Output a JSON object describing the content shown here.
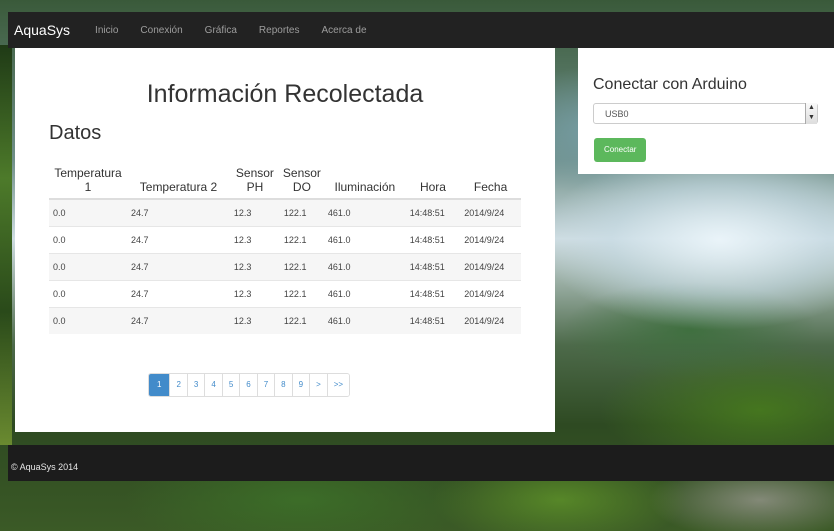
{
  "navbar": {
    "brand": "AquaSys",
    "items": [
      "Inicio",
      "Conexión",
      "Gráfica",
      "Reportes",
      "Acerca de"
    ]
  },
  "main": {
    "title": "Información Recolectada",
    "subtitle": "Datos",
    "columns": [
      "Temperatura 1",
      "Temperatura 2",
      "Sensor PH",
      "Sensor DO",
      "Iluminación",
      "Hora",
      "Fecha"
    ],
    "rows": [
      [
        "0.0",
        "24.7",
        "12.3",
        "122.1",
        "461.0",
        "14:48:51",
        "2014/9/24"
      ],
      [
        "0.0",
        "24.7",
        "12.3",
        "122.1",
        "461.0",
        "14:48:51",
        "2014/9/24"
      ],
      [
        "0.0",
        "24.7",
        "12.3",
        "122.1",
        "461.0",
        "14:48:51",
        "2014/9/24"
      ],
      [
        "0.0",
        "24.7",
        "12.3",
        "122.1",
        "461.0",
        "14:48:51",
        "2014/9/24"
      ],
      [
        "0.0",
        "24.7",
        "12.3",
        "122.1",
        "461.0",
        "14:48:51",
        "2014/9/24"
      ]
    ],
    "pagination": [
      "1",
      "2",
      "3",
      "4",
      "5",
      "6",
      "7",
      "8",
      "9",
      ">",
      ">>"
    ],
    "active_page": "1"
  },
  "side": {
    "title": "Conectar con Arduino",
    "port_selected": "USB0",
    "connect_label": "Conectar"
  },
  "footer": {
    "text": "© AquaSys 2014"
  },
  "colors": {
    "navbar": "#222222",
    "accent": "#428bca",
    "success": "#5cb85c"
  }
}
